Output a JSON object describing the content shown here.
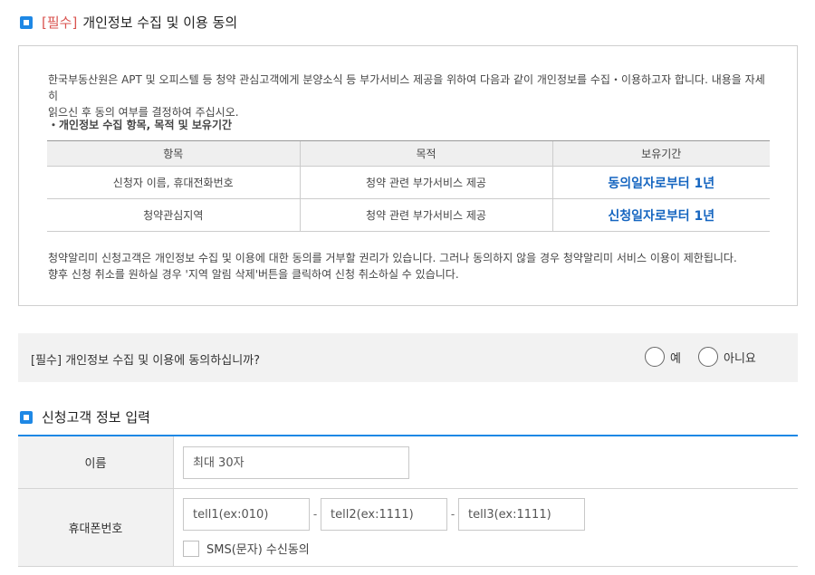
{
  "privacy_section": {
    "required_tag": "[필수]",
    "title": "개인정보 수집 및 이용 동의",
    "intro_line1": "한국부동산원은 APT 및 오피스텔 등 청약 관심고객에게 분양소식 등 부가서비스 제공을 위하여 다음과 같이 개인정보를 수집・이용하고자 합니다. 내용을 자세히",
    "intro_line2": "읽으신 후 동의 여부를 결정하여 주십시오.",
    "subheading": "・개인정보 수집 항목, 목적 및 보유기간",
    "table": {
      "headers": [
        "항목",
        "목적",
        "보유기간"
      ],
      "rows": [
        [
          "신청자 이름, 휴대전화번호",
          "청약 관련 부가서비스 제공",
          "동의일자로부터 1년"
        ],
        [
          "청약관심지역",
          "청약 관련 부가서비스 제공",
          "신청일자로부터 1년"
        ]
      ]
    },
    "notice_line1": "청약알리미 신청고객은 개인정보 수집 및 이용에 대한 동의를 거부할 권리가 있습니다. 그러나 동의하지 않을 경우 청약알리미 서비스 이용이 제한됩니다.",
    "notice_line2": "향후 신청 취소를 원하실 경우 '지역 알림 삭제'버튼을 클릭하여 신청 취소하실 수 있습니다."
  },
  "consent": {
    "question_tag": "[필수]",
    "question": "개인정보 수집 및 이용에 동의하십니까?",
    "options": [
      "예",
      "아니요"
    ]
  },
  "customer_section": {
    "title": "신청고객 정보 입력",
    "name_label": "이름",
    "name_placeholder": "최대 30자",
    "phone_label": "휴대폰번호",
    "phone_placeholders": [
      "tell1(ex:010)",
      "tell2(ex:1111)",
      "tell3(ex:1111)"
    ],
    "phone_separator": "-",
    "sms_label": "SMS(문자) 수신동의"
  },
  "colors": {
    "accent": "#1e88e5",
    "required": "#d9534f",
    "period": "#1565c0"
  }
}
